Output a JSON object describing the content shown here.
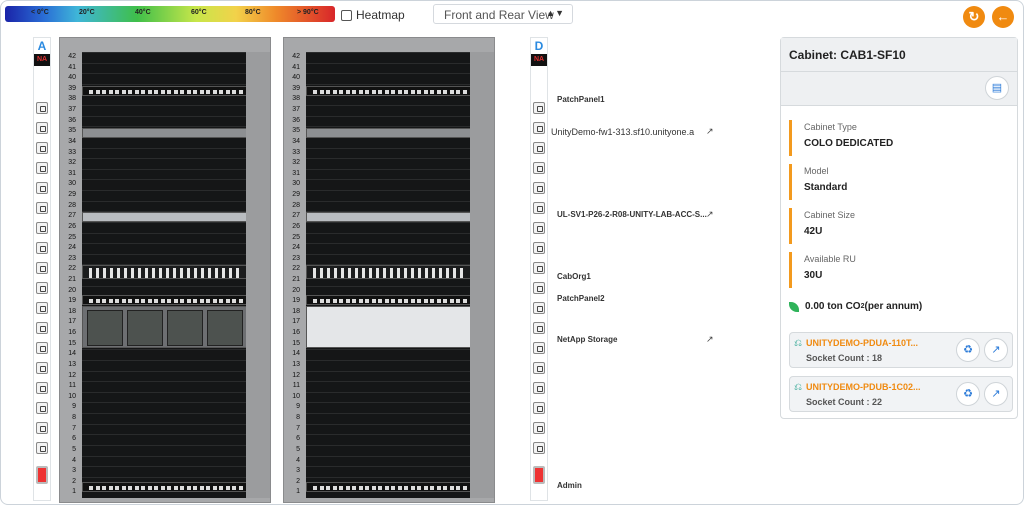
{
  "toolbar": {
    "legend": [
      "< 0°C",
      "20°C",
      "40°C",
      "60°C",
      "80°C",
      "> 90°C"
    ],
    "heatmap_label": "Heatmap",
    "view_select": "Front and Rear View",
    "refresh_icon": "refresh-icon",
    "back_icon": "arrow-left-icon"
  },
  "pdu_left": {
    "label": "A",
    "status": "NA"
  },
  "pdu_right": {
    "label": "D",
    "status": "NA"
  },
  "rack_units": [
    "42",
    "41",
    "40",
    "39",
    "38",
    "37",
    "36",
    "35",
    "34",
    "33",
    "32",
    "31",
    "30",
    "29",
    "28",
    "27",
    "26",
    "25",
    "24",
    "23",
    "22",
    "21",
    "20",
    "19",
    "18",
    "17",
    "16",
    "15",
    "14",
    "13",
    "12",
    "11",
    "10",
    "9",
    "8",
    "7",
    "6",
    "5",
    "4",
    "3",
    "2",
    "1"
  ],
  "devices": {
    "patch1": "PatchPanel1",
    "fw": "UnityDemo-fw1-313.sf10.unityone.a",
    "switch": "UL-SV1-P26-2-R08-UNITY-LAB-ACC-S...",
    "cabOrg": "CabOrg1",
    "patch2": "PatchPanel2",
    "storage": "NetApp Storage",
    "admin": "Admin"
  },
  "panel": {
    "title": "Cabinet: CAB1-SF10",
    "attrs": [
      {
        "key": "Cabinet Type",
        "value": "COLO DEDICATED"
      },
      {
        "key": "Model",
        "value": "Standard"
      },
      {
        "key": "Cabinet Size",
        "value": "42U"
      },
      {
        "key": "Available RU",
        "value": "30U"
      }
    ],
    "co2_value": "0.00 ton CO",
    "co2_sub": "2",
    "co2_suffix": " (per annum)",
    "pdus": [
      {
        "name": "UNITYDEMO-PDUA-110T...",
        "sockets": "Socket Count : 18"
      },
      {
        "name": "UNITYDEMO-PDUB-1C02...",
        "sockets": "Socket Count : 22"
      }
    ]
  },
  "colors": {
    "accent": "#f08a10",
    "link": "#2a8ae0",
    "ok": "#29b464"
  }
}
